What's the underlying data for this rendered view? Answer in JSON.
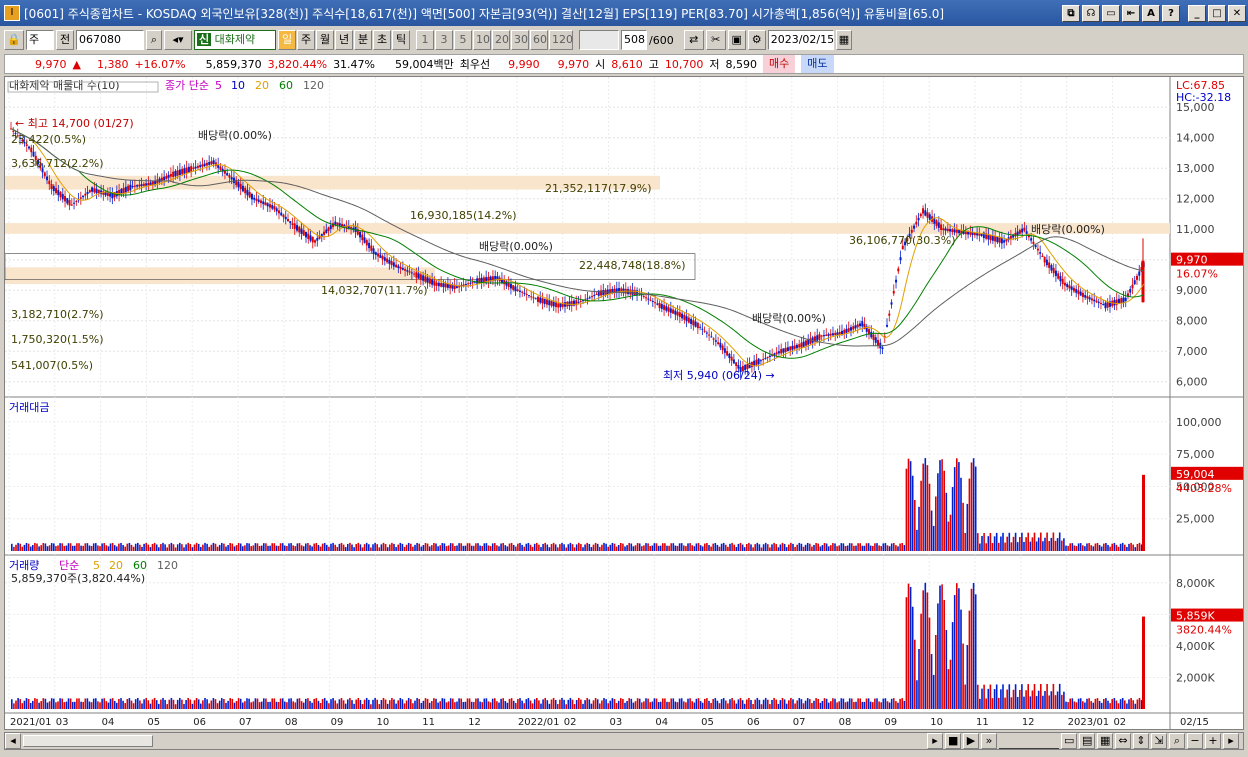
{
  "window": {
    "app_icon": "I",
    "title": "[0601] 주식종합차트 - KOSDAQ 외국인보유[328(천)] 주식수[18,617(천)] 액면[500] 자본금[93(억)] 결산[12월] EPS[119] PER[83.70] 시가총액[1,856(억)] 유통비율[65.0]",
    "buttons": [
      "⧉",
      "☊",
      "▭",
      "⇤",
      "A",
      "?",
      "_",
      "□",
      "✕"
    ]
  },
  "toolbar": {
    "period_select": "주",
    "all_label": "전",
    "code": "067080",
    "stock_name": "대화제약",
    "stock_prefix": "신",
    "periods": [
      "일",
      "주",
      "월",
      "년",
      "분",
      "초",
      "틱"
    ],
    "selected_period": "일",
    "intervals": [
      "1",
      "3",
      "5",
      "10",
      "20",
      "30",
      "60",
      "120"
    ],
    "count": "508",
    "count_total": "/600",
    "date": "2023/02/15"
  },
  "quote": {
    "price": "9,970",
    "change_arrow": "▲",
    "change": "1,380",
    "change_pct": "+16.07%",
    "volume": "5,859,370",
    "volume_pct": "3,820.44%",
    "turnover": "31.47%",
    "amount": "59,004백만",
    "best_bid_label": "최우선",
    "best_ask": "9,990",
    "best_bid": "9,970",
    "open_label": "시",
    "open": "8,610",
    "high_label": "고",
    "high": "10,700",
    "low_label": "저",
    "low": "8,590",
    "buy_label": "매수",
    "sell_label": "매도"
  },
  "price_panel": {
    "legend_volume_profile": "대화제약 매물대 수(10)",
    "legend_ma": "종가 단순",
    "ma_periods": [
      "5",
      "10",
      "20",
      "60",
      "120"
    ],
    "ma_colors": [
      "#c000c0",
      "#0000c0",
      "#e0a000",
      "#008000",
      "#606060"
    ],
    "lc": "LC:67.85",
    "hc": "HC:-32.18",
    "y_ticks": [
      "15,000",
      "14,000",
      "13,000",
      "12,000",
      "11,000",
      "10,000",
      "9,000",
      "8,000",
      "7,000",
      "6,000"
    ],
    "price_tag": "9,970",
    "pct_tag": "16.07%",
    "annotations": {
      "high": "← 최고 14,700 (01/27)",
      "low": "최저 5,940 (06/24) →",
      "div1": "배당락(0.00%)",
      "div2": "배당락(0.00%)",
      "div3": "배당락(0.00%)",
      "div4": "배당락(0.00%)"
    },
    "profile_labels": [
      "23,422(0.5%)",
      "3,636,712(2.2%)",
      "21,352,117(17.9%)",
      "16,930,185(14.2%)",
      "22,448,748(18.8%)",
      "14,032,707(11.7%)",
      "36,106,770(30.3%)",
      "3,182,710(2.7%)",
      "1,750,320(1.5%)",
      "541,007(0.5%)"
    ]
  },
  "amount_panel": {
    "legend": "거래대금",
    "y_ticks": [
      "100,000",
      "75,000",
      "50,000",
      "25,000"
    ],
    "tag_value": "59,004",
    "tag_pct": "4403.28%"
  },
  "volume_panel": {
    "legend": "거래량",
    "legend_ma": "단순",
    "ma_periods": [
      "5",
      "20",
      "60",
      "120"
    ],
    "value_line": "5,859,370주(3,820.44%)",
    "y_ticks": [
      "8,000K",
      "6,000K",
      "4,000K",
      "2,000K"
    ],
    "tag_value": "5,859K",
    "tag_pct": "3820.44%"
  },
  "x_axis": [
    "2021/01",
    "03",
    "04",
    "05",
    "06",
    "07",
    "08",
    "09",
    "10",
    "11",
    "12",
    "2022/01",
    "02",
    "03",
    "04",
    "05",
    "06",
    "07",
    "08",
    "09",
    "10",
    "11",
    "12",
    "2023/01",
    "02"
  ],
  "x_axis_right": "02/15",
  "chart_data": {
    "type": "candlestick",
    "approx_close_path": [
      14300,
      13600,
      12400,
      11800,
      12300,
      12100,
      12400,
      12500,
      12800,
      13000,
      13200,
      12600,
      12000,
      11700,
      11100,
      10600,
      11200,
      11000,
      10200,
      9800,
      9500,
      9200,
      9100,
      9300,
      9400,
      9000,
      8700,
      8500,
      8600,
      8900,
      9000,
      8900,
      8500,
      8200,
      7800,
      7200,
      6400,
      6700,
      7000,
      7200,
      7500,
      7600,
      7900,
      7100,
      10400,
      11600,
      11000,
      10900,
      10800,
      10600,
      11000,
      10000,
      9200,
      8800,
      8500,
      8700,
      9970
    ]
  }
}
